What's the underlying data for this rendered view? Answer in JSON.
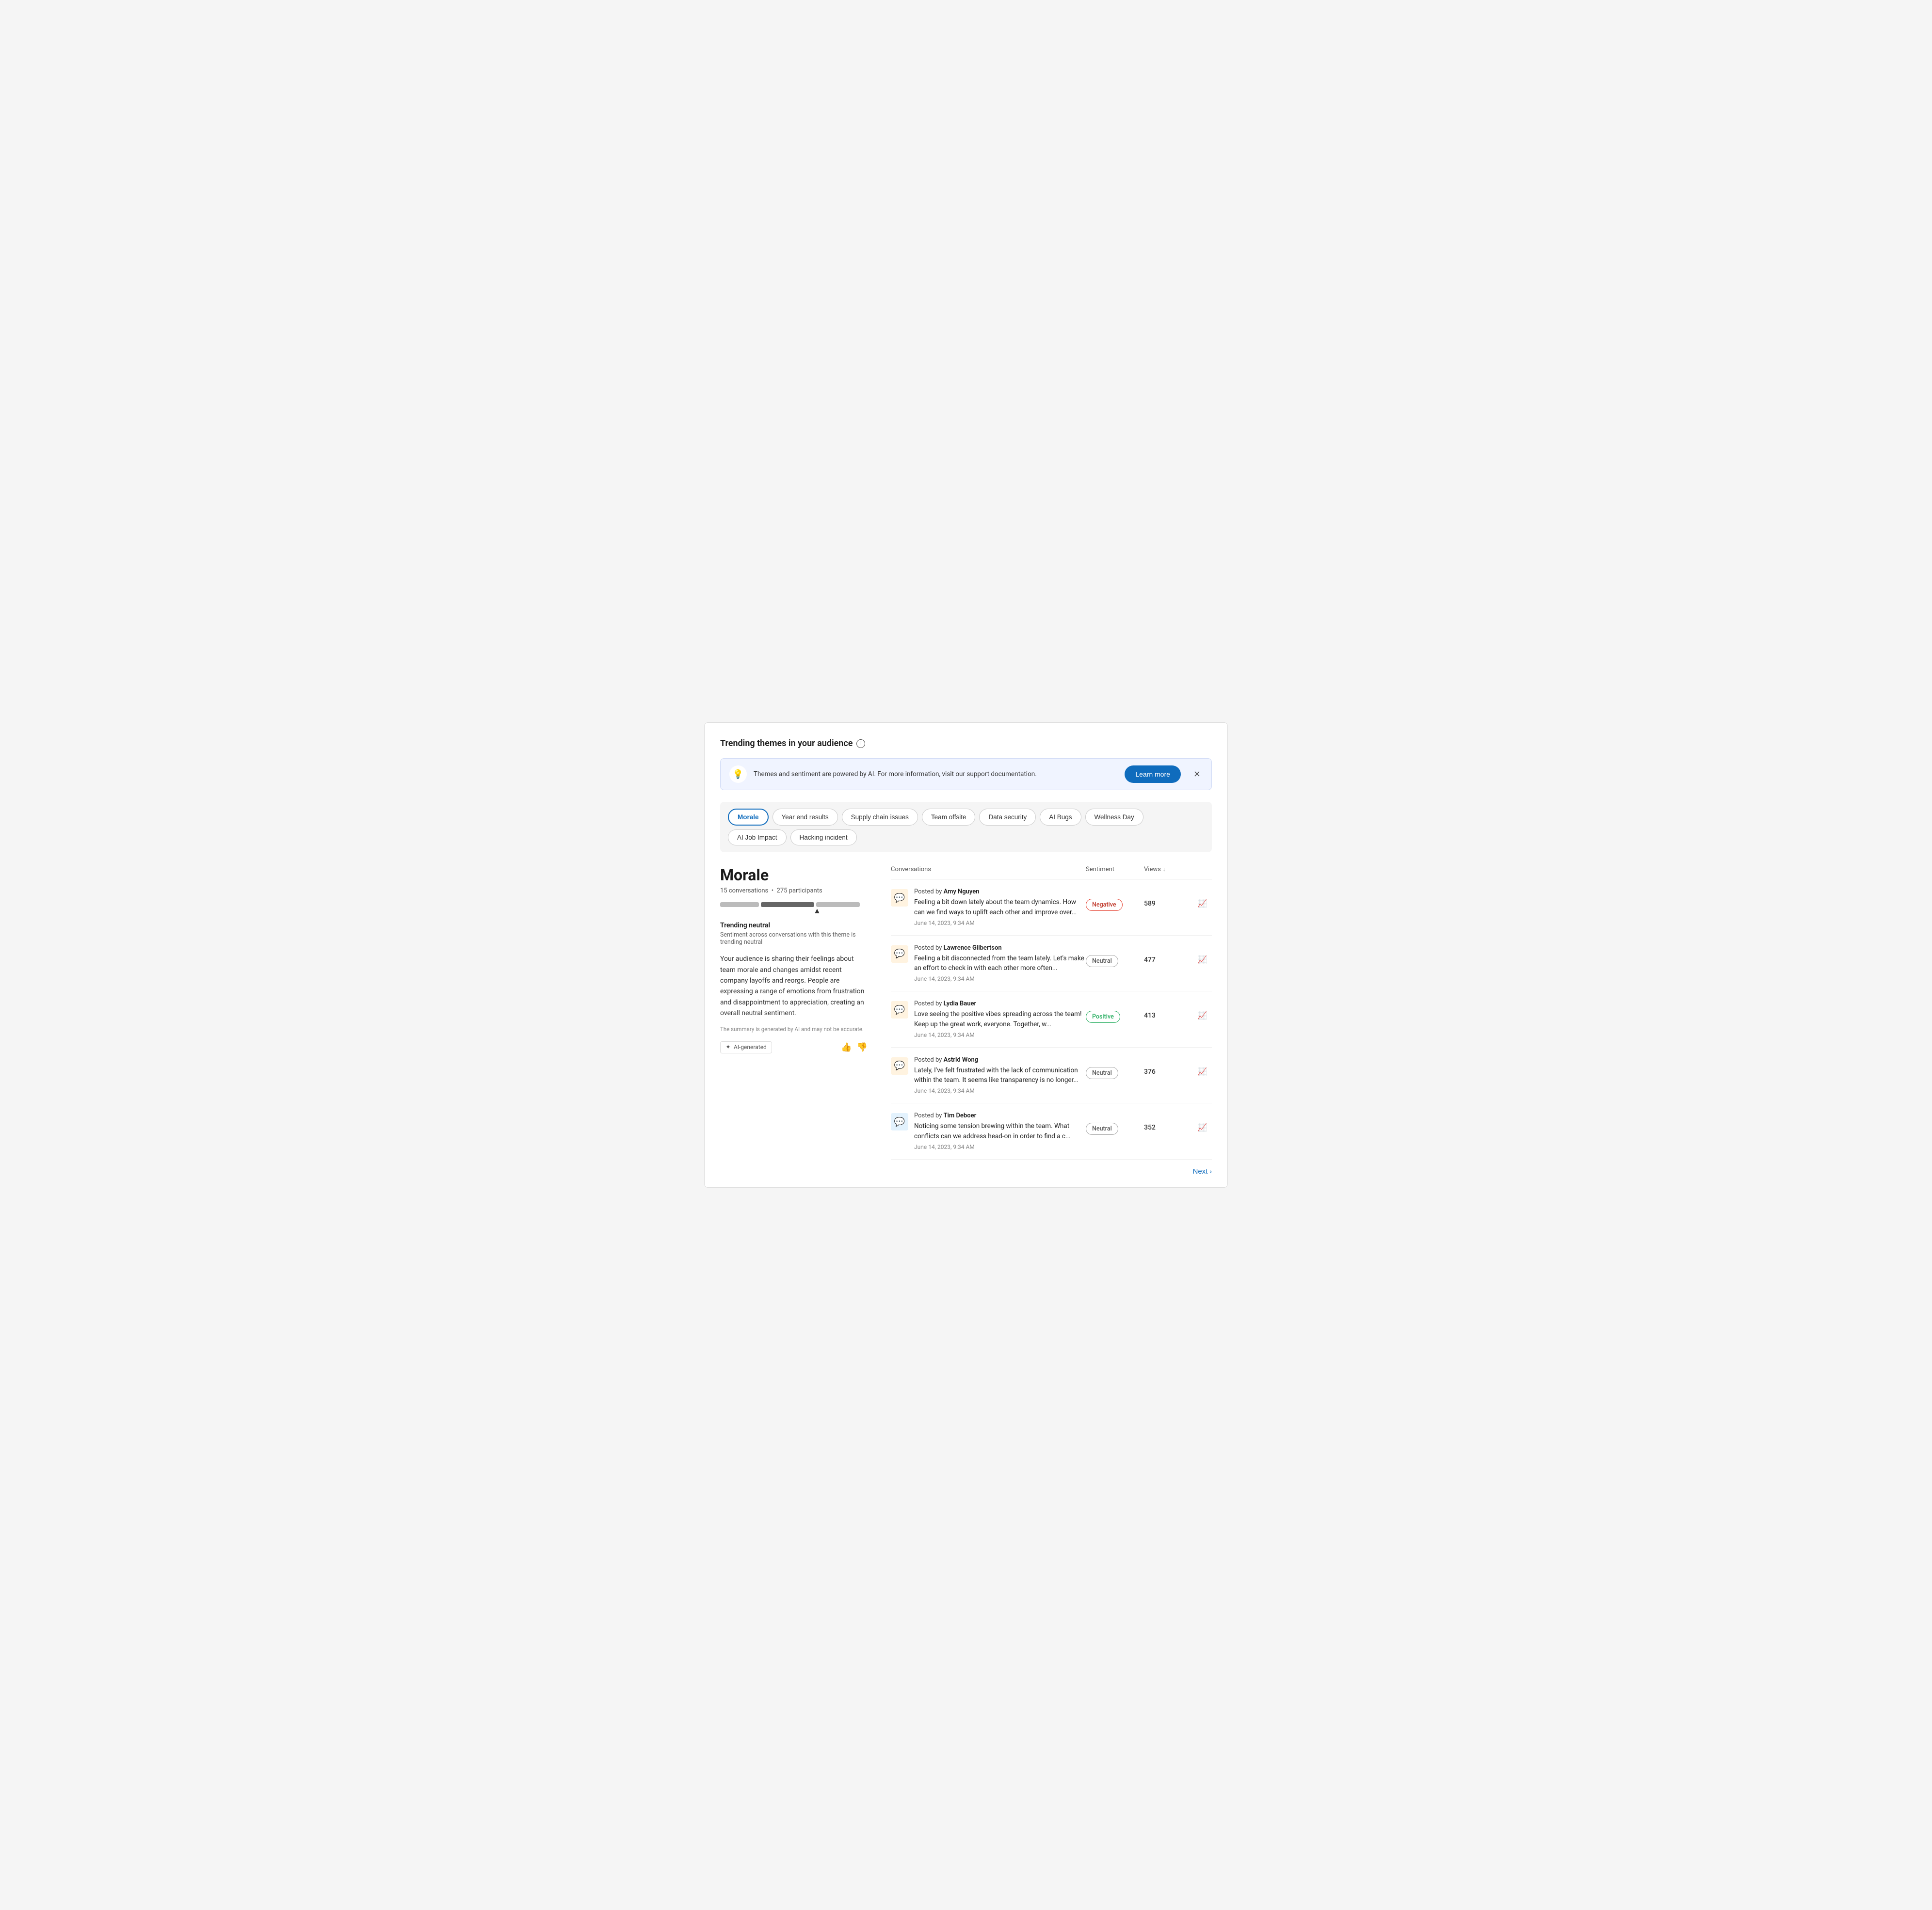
{
  "page": {
    "title": "Trending themes in your audience"
  },
  "banner": {
    "text": "Themes and sentiment are powered by AI. For more information, visit our support documentation.",
    "learn_more_label": "Learn more"
  },
  "themes": {
    "tabs": [
      {
        "id": "morale",
        "label": "Morale",
        "active": true
      },
      {
        "id": "year-end-results",
        "label": "Year end results",
        "active": false
      },
      {
        "id": "supply-chain-issues",
        "label": "Supply chain issues",
        "active": false
      },
      {
        "id": "team-offsite",
        "label": "Team offsite",
        "active": false
      },
      {
        "id": "data-security",
        "label": "Data security",
        "active": false
      },
      {
        "id": "ai-bugs",
        "label": "AI Bugs",
        "active": false
      },
      {
        "id": "wellness-day",
        "label": "Wellness Day",
        "active": false
      },
      {
        "id": "ai-job-impact",
        "label": "AI Job Impact",
        "active": false
      },
      {
        "id": "hacking-incident",
        "label": "Hacking incident",
        "active": false
      }
    ]
  },
  "selected_theme": {
    "name": "Morale",
    "conversations_count": "15 conversations",
    "participants_count": "275 participants",
    "trending_label": "Trending neutral",
    "trending_desc": "Sentiment across conversations with this theme is trending neutral",
    "summary": "Your audience is sharing their feelings about team morale and changes amidst recent company layoffs and reorgs. People are expressing a range of emotions from frustration and disappointment to appreciation, creating an overall neutral sentiment.",
    "ai_disclaimer": "The summary is generated by AI and may not be accurate.",
    "ai_generated_label": "AI-generated"
  },
  "table": {
    "col_conversations": "Conversations",
    "col_sentiment": "Sentiment",
    "col_views": "Views",
    "conversations": [
      {
        "id": 1,
        "author": "Amy Nguyen",
        "text": "Feeling a bit down lately about the team dynamics. How can we find ways to uplift each other and improve over...",
        "date": "June 14, 2023, 9:34 AM",
        "sentiment": "Negative",
        "sentiment_type": "negative",
        "views": "589",
        "icon_type": "orange"
      },
      {
        "id": 2,
        "author": "Lawrence Gilbertson",
        "text": "Feeling a bit disconnected from the team lately. Let's make an effort to check in with each other more often...",
        "date": "June 14, 2023, 9:34 AM",
        "sentiment": "Neutral",
        "sentiment_type": "neutral",
        "views": "477",
        "icon_type": "orange"
      },
      {
        "id": 3,
        "author": "Lydia Bauer",
        "text": "Love seeing the positive vibes spreading across the team! Keep up the great work, everyone. Together, w...",
        "date": "June 14, 2023, 9:34 AM",
        "sentiment": "Positive",
        "sentiment_type": "positive",
        "views": "413",
        "icon_type": "orange"
      },
      {
        "id": 4,
        "author": "Astrid Wong",
        "text": "Lately, I've felt frustrated with the lack of communication within the team. It seems like transparency is no longer...",
        "date": "June 14, 2023, 9:34 AM",
        "sentiment": "Neutral",
        "sentiment_type": "neutral",
        "views": "376",
        "icon_type": "orange"
      },
      {
        "id": 5,
        "author": "Tim Deboer",
        "text": "Noticing some tension brewing within the team. What conflicts can we address head-on in order to find a c...",
        "date": "June 14, 2023, 9:34 AM",
        "sentiment": "Neutral",
        "sentiment_type": "neutral",
        "views": "352",
        "icon_type": "blue"
      }
    ]
  },
  "pagination": {
    "next_label": "Next"
  }
}
